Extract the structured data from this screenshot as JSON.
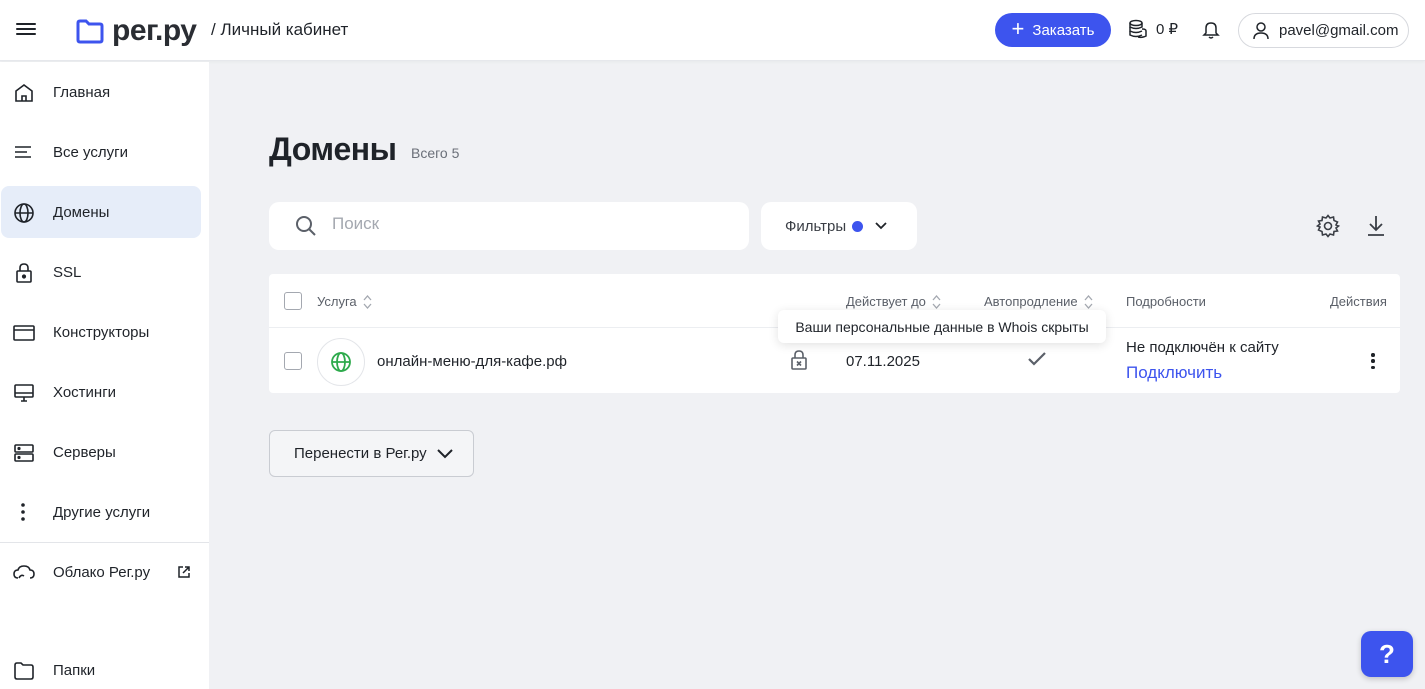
{
  "header": {
    "logo_text": "рег.ру",
    "breadcrumb": "/ Личный кабинет",
    "order_label": "Заказать",
    "balance": "0 ₽",
    "user_email": "pavel@gmail.com",
    "accent_color": "#3d54ee"
  },
  "sidebar": {
    "items": [
      {
        "label": "Главная",
        "icon": "home-icon"
      },
      {
        "label": "Все услуги",
        "icon": "list-icon"
      },
      {
        "label": "Домены",
        "icon": "globe-icon",
        "active": true
      },
      {
        "label": "SSL",
        "icon": "lock-icon"
      },
      {
        "label": "Конструкторы",
        "icon": "window-icon"
      },
      {
        "label": "Хостинги",
        "icon": "monitor-icon"
      },
      {
        "label": "Серверы",
        "icon": "server-icon"
      },
      {
        "label": "Другие услуги",
        "icon": "more-vertical-icon"
      }
    ],
    "cloud": {
      "label": "Облако Рег.ру",
      "icon": "cloud-icon"
    },
    "folders": {
      "label": "Папки",
      "icon": "folder-icon"
    }
  },
  "main": {
    "title": "Домены",
    "count": "Всего 5",
    "search_placeholder": "Поиск",
    "filters_label": "Фильтры",
    "table": {
      "columns": {
        "service": "Услуга",
        "valid_until": "Действует до",
        "autorenew": "Автопродление",
        "details": "Подробности",
        "actions": "Действия"
      },
      "rows": [
        {
          "domain": "онлайн-меню-для-кафе.рф",
          "date": "07.11.2025",
          "details": "Не подключён к сайту",
          "connect": "Подключить"
        }
      ]
    },
    "tooltip": "Ваши персональные данные в Whois скрыты",
    "transfer_label": "Перенести в Рег.ру",
    "help_label": "?"
  }
}
